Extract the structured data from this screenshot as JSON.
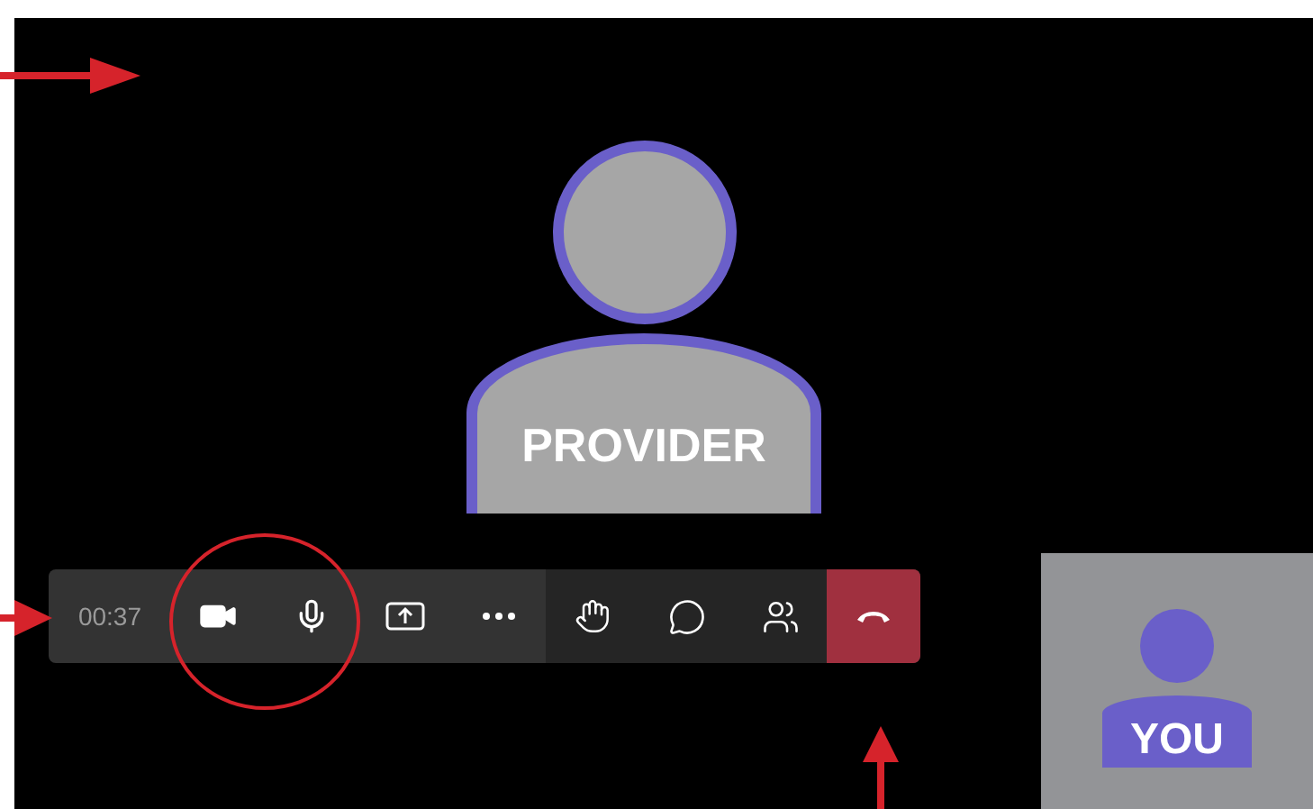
{
  "call": {
    "timer": "00:37"
  },
  "toolbar": {
    "groups": [
      {
        "kind": "media",
        "buttons": [
          {
            "kind": "camera"
          },
          {
            "kind": "mic"
          },
          {
            "kind": "share"
          },
          {
            "kind": "more"
          }
        ]
      },
      {
        "kind": "social",
        "buttons": [
          {
            "kind": "hand"
          },
          {
            "kind": "chat"
          },
          {
            "kind": "people"
          }
        ]
      },
      {
        "kind": "leave",
        "buttons": [
          {
            "kind": "hangup"
          }
        ]
      }
    ]
  },
  "participant": {
    "label": "PROVIDER"
  },
  "self_view": {
    "label": "YOU"
  }
}
